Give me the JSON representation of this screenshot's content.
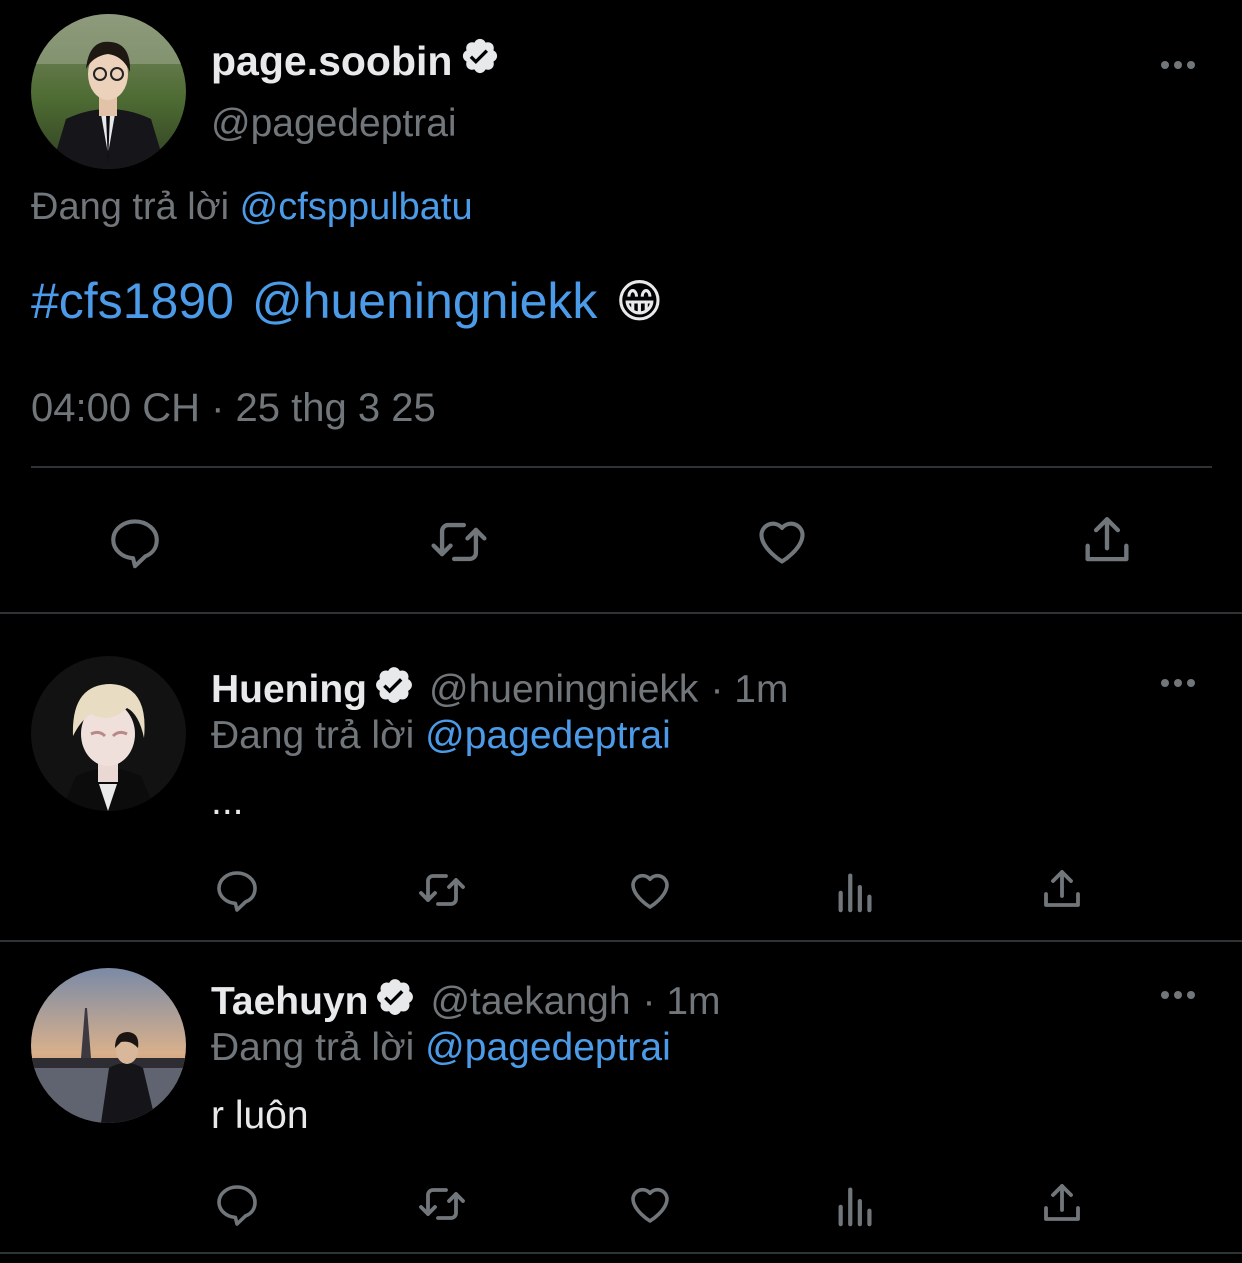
{
  "main_tweet": {
    "display_name": "page.soobin",
    "handle": "@pagedeptrai",
    "reply_prefix": "Đang trả lời",
    "reply_to": "@cfsppulbatu",
    "hashtag": "#cfs1890",
    "mention": "@hueningniekk",
    "emoji": "😁",
    "timestamp": "04:00 CH · 25 thg 3 25"
  },
  "replies": [
    {
      "display_name": "Huening",
      "handle": "@hueningniekk",
      "time": "· 1m",
      "reply_prefix": "Đang trả lời",
      "reply_to": "@pagedeptrai",
      "text": "..."
    },
    {
      "display_name": "Taehuyn",
      "handle": "@taekangh",
      "time": "· 1m",
      "reply_prefix": "Đang trả lời",
      "reply_to": "@pagedeptrai",
      "text": "r luôn"
    }
  ],
  "icons": [
    "verified-badge-icon",
    "more-options-icon",
    "reply-icon",
    "retweet-icon",
    "like-icon",
    "views-icon",
    "share-icon"
  ],
  "colors": {
    "background": "#000000",
    "text": "#e7e9ea",
    "muted": "#71767b",
    "link": "#4c9be8",
    "divider": "#2f3336"
  }
}
